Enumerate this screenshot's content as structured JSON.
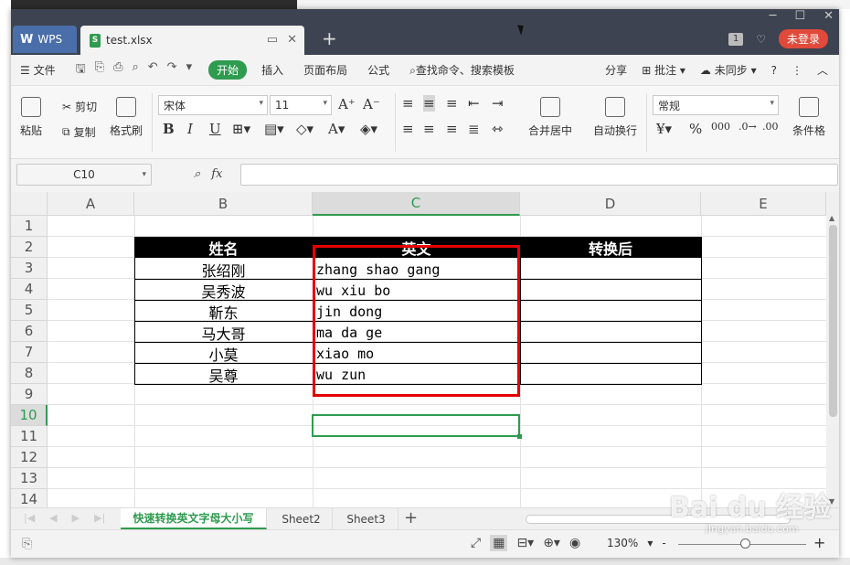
{
  "titlebar": {
    "app_tab": "WPS",
    "file_tab": "test.xlsx",
    "file_icon": "S",
    "add_tab": "+",
    "badge": "1",
    "login": "未登录",
    "controls": [
      "─",
      "☐",
      "✕"
    ]
  },
  "menubar": {
    "file": "文件",
    "items": [
      "开始",
      "插入",
      "页面布局",
      "公式"
    ],
    "search": "查找命令、搜索模板",
    "share": "分享",
    "comment": "批注",
    "sync": "未同步"
  },
  "ribbon": {
    "paste": "粘贴",
    "cut": "剪切",
    "copy": "复制",
    "format_painter": "格式刷",
    "font": "宋体",
    "font_size": "11",
    "bold": "B",
    "italic": "I",
    "underline": "U",
    "merge": "合并居中",
    "wrap": "自动换行",
    "number_format": "常规",
    "percent": "%",
    "cond_format": "条件格"
  },
  "formula_bar": {
    "name_box": "C10",
    "fx": "fx",
    "value": ""
  },
  "grid": {
    "columns": [
      "A",
      "B",
      "C",
      "D",
      "E"
    ],
    "rows": [
      "1",
      "2",
      "3",
      "4",
      "5",
      "6",
      "7",
      "8",
      "9",
      "10",
      "11",
      "12",
      "13",
      "14"
    ],
    "headers": [
      "姓名",
      "英文",
      "转换后"
    ],
    "names": [
      "张绍刚",
      "吴秀波",
      "靳东",
      "马大哥",
      "小莫",
      "吴尊"
    ],
    "english": [
      "zhang shao gang",
      "wu xiu bo",
      "jin dong",
      "ma da ge",
      "xiao mo",
      "wu zun"
    ]
  },
  "sheets": {
    "tabs": [
      "快速转换英文字母大小写",
      "Sheet2",
      "Sheet3"
    ],
    "add": "+"
  },
  "status": {
    "zoom": "130%",
    "minus": "-",
    "plus": "+"
  },
  "watermark": {
    "brand": "Bai du 经验",
    "url": "jingyan.baidu.com"
  },
  "colors": {
    "accent_green": "#2e9b4f",
    "highlight_red": "#e50000",
    "titlebar": "#3d4350",
    "login_red": "#e04a3a"
  }
}
